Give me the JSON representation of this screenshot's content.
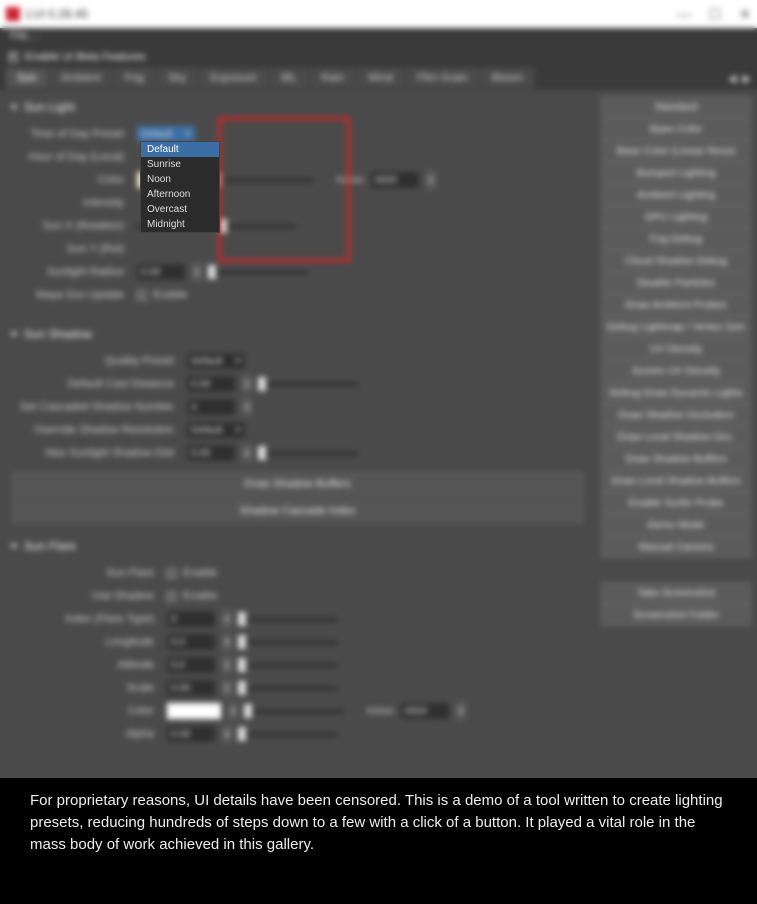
{
  "window": {
    "title": "LUI  0.28.45",
    "min_label": "—",
    "max_label": "☐",
    "close_label": "✕"
  },
  "menubar": {
    "file": "File…"
  },
  "beta": {
    "label": "Enable UI Beta Features"
  },
  "tabs": {
    "items": [
      {
        "label": "Sun",
        "active": true
      },
      {
        "label": "Ambient"
      },
      {
        "label": "Fog"
      },
      {
        "label": "Sky"
      },
      {
        "label": "Exposure"
      },
      {
        "label": "IBL"
      },
      {
        "label": "Rain"
      },
      {
        "label": "Wind"
      },
      {
        "label": "Film Grain"
      },
      {
        "label": "Bloom"
      }
    ],
    "arrow_left": "◀",
    "arrow_right": "▶"
  },
  "right_buttons": [
    "Standard",
    "Base Color",
    "Base Color (Linear Reso)",
    "Bumped Lighting",
    "Ambient Lighting",
    "GPU Lighting",
    "Fog Debug",
    "Cloud Shadow Debug",
    "Disable Particles",
    "Draw Ambient Probes",
    "Debug Lightmap / Vertex Gen",
    "UV Density",
    "Screen UV Density",
    "Debug Draw Dynamic Lights",
    "Draw Shadow Occluders",
    "Draw Local Shadow Occ.",
    "Draw Shadow Buffers",
    "Draw Local Shadow Buffers",
    "Enable Surfer Probe",
    "Demo Mode",
    "Manual Camera"
  ],
  "right_extra": [
    "Take Screenshot",
    "Screenshot Folder"
  ],
  "sun_light": {
    "title": "Sun Light",
    "tod_preset_label": "Time of Day Preset",
    "tod_preset_value": "Default",
    "tod_options": [
      "Default",
      "Sunrise",
      "Noon",
      "Afternoon",
      "Overcast",
      "Midnight"
    ],
    "hod_label": "Hour of Day (Local)",
    "color_label": "Color",
    "color_hex": "#f2e3c6",
    "kelvin_label": "Kelvin",
    "kelvin_value": "6500",
    "intensity_label": "Intensity",
    "rotx_label": "Sun X (Rotation)",
    "roty_label": "Sun Y (Rot)",
    "radius_label": "Sunlight Radius",
    "radius_value": "0.00",
    "update_label": "Maya Sun Update",
    "enable": "Enable"
  },
  "sun_shadow": {
    "title": "Sun Shadow",
    "quality_label": "Quality Preset",
    "quality_value": "Default",
    "cast_label": "Default Cast Distance",
    "cast_value": "0.00",
    "cascades_label": "Set Cascaded Shadow Number",
    "cascades_value": "4",
    "override_label": "Override Shadow Resolution",
    "override_value": "Default",
    "maxdist_label": "Max Sunlight Shadow Dist",
    "maxdist_value": "0.00",
    "btn1": "Draw Shadow Buffers",
    "btn2": "Shadow Cascade Index"
  },
  "sun_flare": {
    "title": "Sun Flare",
    "flare_label": "Sun Flare",
    "useshadow_label": "Use Shadow",
    "enable": "Enable",
    "index_label": "Index (Flare Type)",
    "index_value": "0",
    "long_label": "Longitude",
    "long_value": "0.0",
    "alt_label": "Altitude",
    "alt_value": "0.0",
    "scale_label": "Scale",
    "scale_value": "0.00",
    "color_label": "Color",
    "color_hex": "#ffffff",
    "kelvin_label": "Kelvin",
    "kelvin_value": "6500",
    "alpha_label": "Alpha",
    "alpha_value": "0.00"
  },
  "caption": "For proprietary reasons, UI details have been censored. This is a demo of a tool written to create lighting presets, reducing hundreds of steps down to a few with a click of a button. It played a vital role in the mass body of work achieved in this gallery."
}
